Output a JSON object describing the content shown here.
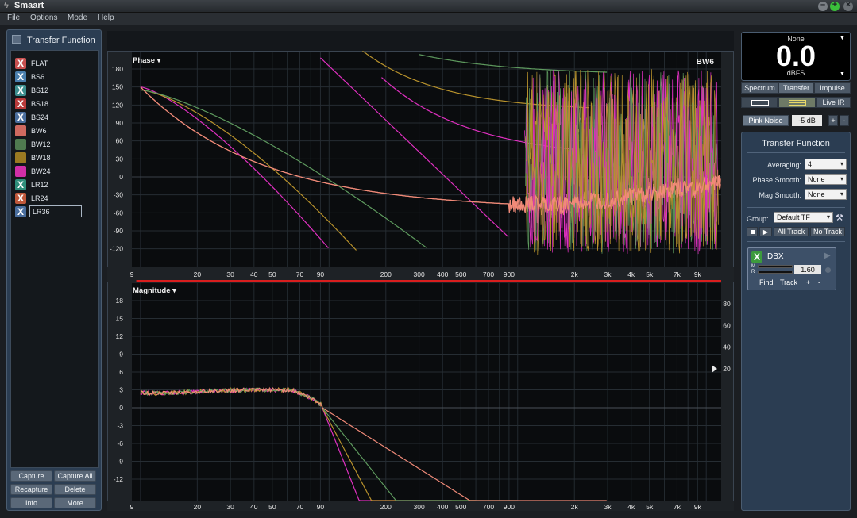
{
  "window": {
    "title": "Smaart"
  },
  "menu": [
    "File",
    "Options",
    "Mode",
    "Help"
  ],
  "left_panel": {
    "title": "Transfer Function",
    "traces": [
      {
        "name": "FLAT",
        "badge": "X",
        "color": "#c85050"
      },
      {
        "name": "BS6",
        "badge": "X",
        "color": "#4a7fae"
      },
      {
        "name": "BS12",
        "badge": "X",
        "color": "#3d8f8f"
      },
      {
        "name": "BS18",
        "badge": "X",
        "color": "#b83a3a"
      },
      {
        "name": "BS24",
        "badge": "X",
        "color": "#4a6e9e"
      },
      {
        "name": "BW6",
        "badge": "",
        "color": "#d06a60"
      },
      {
        "name": "BW12",
        "badge": "",
        "color": "#4f7a4f"
      },
      {
        "name": "BW18",
        "badge": "",
        "color": "#9b7a22"
      },
      {
        "name": "BW24",
        "badge": "",
        "color": "#d12fa8"
      },
      {
        "name": "LR12",
        "badge": "X",
        "color": "#2f8e7a"
      },
      {
        "name": "LR24",
        "badge": "X",
        "color": "#c0583a"
      },
      {
        "name": "LR36",
        "badge": "X",
        "color": "#4a6e9e"
      }
    ],
    "buttons": {
      "capture": "Capture",
      "capture_all": "Capture All",
      "recapture": "Recapture",
      "delete": "Delete",
      "info": "Info",
      "more": "More"
    }
  },
  "phase_plot": {
    "title": "Phase",
    "active_trace": "BW6",
    "y_ticks": [
      "180",
      "150",
      "120",
      "90",
      "60",
      "30",
      "0",
      "-30",
      "-60",
      "-90",
      "-120"
    ],
    "y_values": [
      180,
      150,
      120,
      90,
      60,
      30,
      0,
      -30,
      -60,
      -90,
      -120
    ]
  },
  "magnitude_plot": {
    "title": "Magnitude",
    "y_ticks": [
      "18",
      "15",
      "12",
      "9",
      "6",
      "3",
      "0",
      "-3",
      "-6",
      "-9",
      "-12"
    ],
    "y_values": [
      18,
      15,
      12,
      9,
      6,
      3,
      0,
      -3,
      -6,
      -9,
      -12
    ],
    "right_ticks": [
      "80",
      "60",
      "40",
      "20"
    ],
    "right_values": [
      80,
      60,
      40,
      20
    ]
  },
  "freq_axis": {
    "labels": [
      "9",
      "20",
      "30",
      "40",
      "50",
      "70",
      "90",
      "200",
      "300",
      "400",
      "500",
      "700",
      "900",
      "2k",
      "3k",
      "4k",
      "5k",
      "7k",
      "9k"
    ],
    "values": [
      9,
      20,
      30,
      40,
      50,
      70,
      90,
      200,
      300,
      400,
      500,
      700,
      900,
      2000,
      3000,
      4000,
      5000,
      7000,
      9000
    ]
  },
  "curve_colors": {
    "bw6": "#f08a78",
    "bw12": "#5e9a5e",
    "bw18": "#b8922c",
    "bw24": "#e030c0",
    "limit": "#d81e1e"
  },
  "meter": {
    "source": "None",
    "value": "0.0",
    "unit": "dBFS"
  },
  "tabs": {
    "spectrum": "Spectrum",
    "transfer": "Transfer",
    "impulse": "Impulse",
    "live_ir": "Live IR"
  },
  "generator": {
    "label": "Pink Noise",
    "level": "-5 dB",
    "plus": "+",
    "minus": "-"
  },
  "tf_panel": {
    "title": "Transfer Function",
    "averaging_label": "Averaging:",
    "averaging_value": "4",
    "phase_smooth_label": "Phase Smooth:",
    "phase_smooth_value": "None",
    "mag_smooth_label": "Mag Smooth:",
    "mag_smooth_value": "None",
    "group_label": "Group:",
    "group_value": "Default TF",
    "all_track": "All Track",
    "no_track": "No Track",
    "measurement": {
      "badge": "X",
      "name": "DBX",
      "m_label": "M",
      "r_label": "R",
      "delay": "1.60",
      "find": "Find",
      "track": "Track",
      "plus": "+",
      "minus": "-"
    }
  }
}
